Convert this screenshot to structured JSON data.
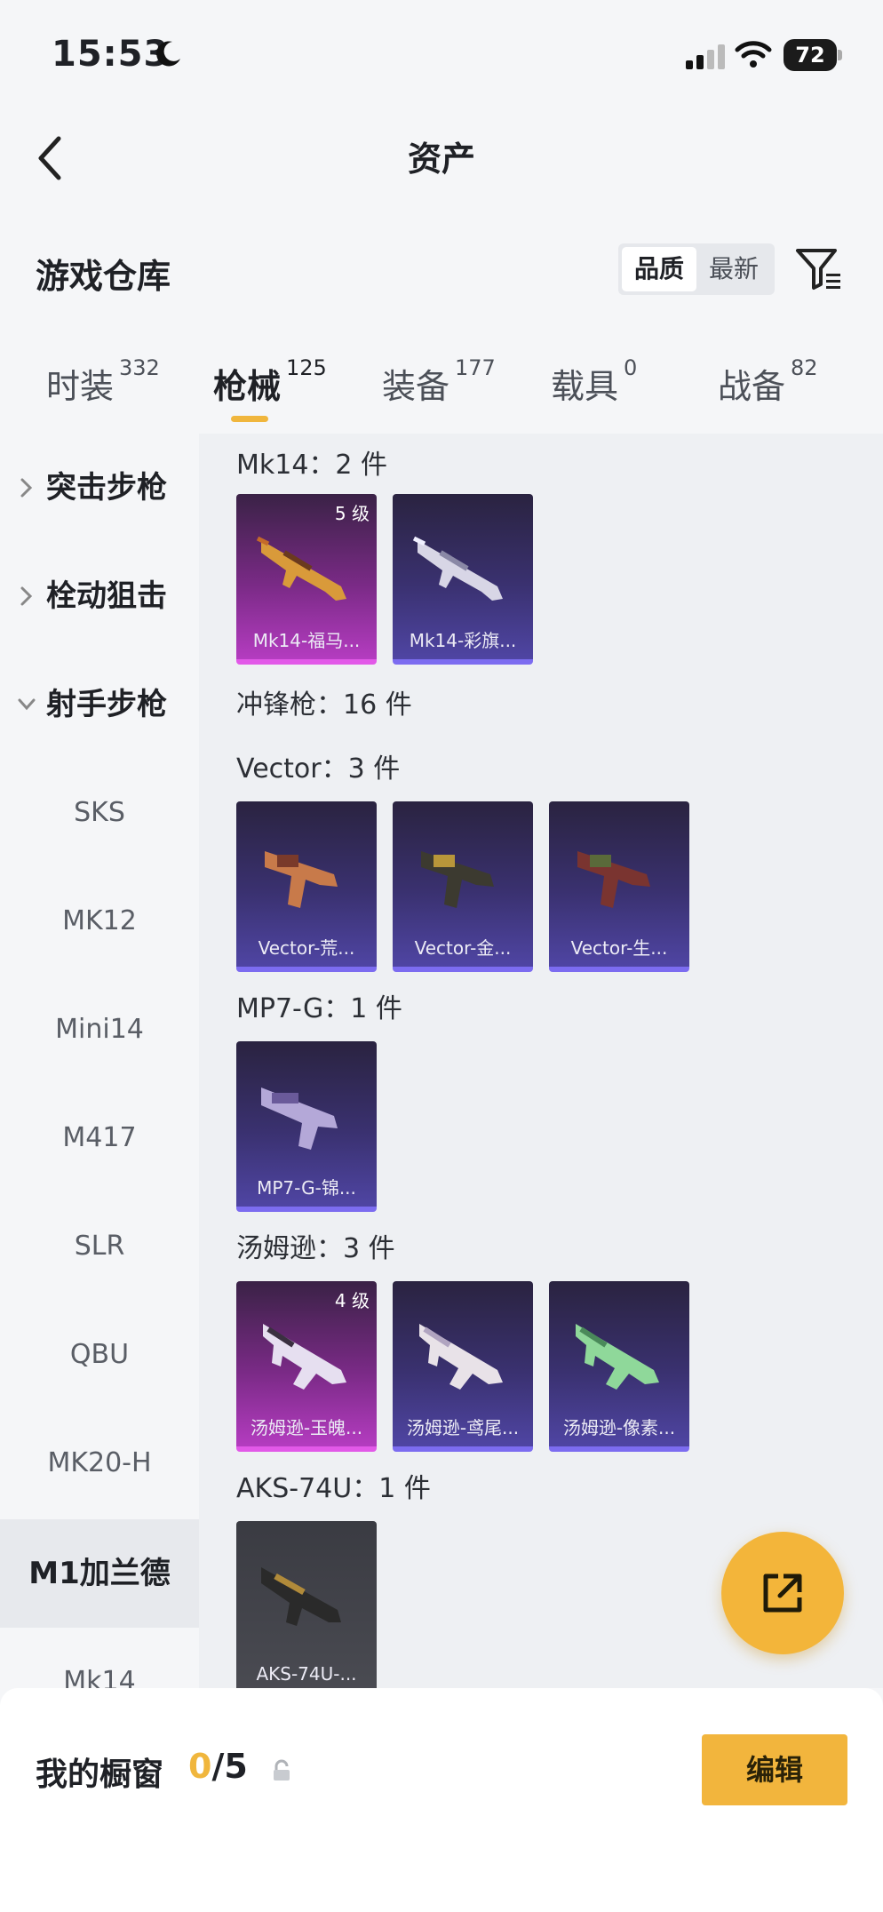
{
  "status_bar": {
    "time": "15:53",
    "battery": "72"
  },
  "nav": {
    "title": "资产"
  },
  "warehouse": {
    "title": "游戏仓库",
    "sort_options": [
      "品质",
      "最新"
    ]
  },
  "tabs": [
    {
      "label": "时装",
      "count": "332"
    },
    {
      "label": "枪械",
      "count": "125"
    },
    {
      "label": "装备",
      "count": "177"
    },
    {
      "label": "载具",
      "count": "0"
    },
    {
      "label": "战备",
      "count": "82"
    }
  ],
  "sidebar": {
    "categories": [
      "突击步枪",
      "栓动狙击",
      "射手步枪"
    ],
    "items": [
      "SKS",
      "MK12",
      "Mini14",
      "M417",
      "SLR",
      "QBU",
      "MK20-H",
      "M1加兰德",
      "Mk14"
    ]
  },
  "groups": [
    {
      "label": "Mk14：2 件",
      "cards": [
        {
          "name": "Mk14-福马...",
          "level": "5 级"
        },
        {
          "name": "Mk14-彩旗..."
        }
      ]
    },
    {
      "label": "冲锋枪：16 件"
    },
    {
      "label": "Vector：3 件",
      "cards": [
        {
          "name": "Vector-荒..."
        },
        {
          "name": "Vector-金..."
        },
        {
          "name": "Vector-生..."
        }
      ]
    },
    {
      "label": "MP7-G：1 件",
      "cards": [
        {
          "name": "MP7-G-锦..."
        }
      ]
    },
    {
      "label": "汤姆逊：3 件",
      "cards": [
        {
          "name": "汤姆逊-玉魄...",
          "level": "4 级"
        },
        {
          "name": "汤姆逊-鸢尾..."
        },
        {
          "name": "汤姆逊-像素..."
        }
      ]
    },
    {
      "label": "AKS-74U：1 件",
      "cards": [
        {
          "name": "AKS-74U-..."
        }
      ]
    }
  ],
  "showcase": {
    "label": "我的橱窗",
    "current": "0",
    "total": "/5",
    "edit_label": "编辑"
  },
  "colors": {
    "accent": "#f0b63d",
    "purple_rarity": "#7c6cf0",
    "pink_rarity": "#e259e8"
  }
}
